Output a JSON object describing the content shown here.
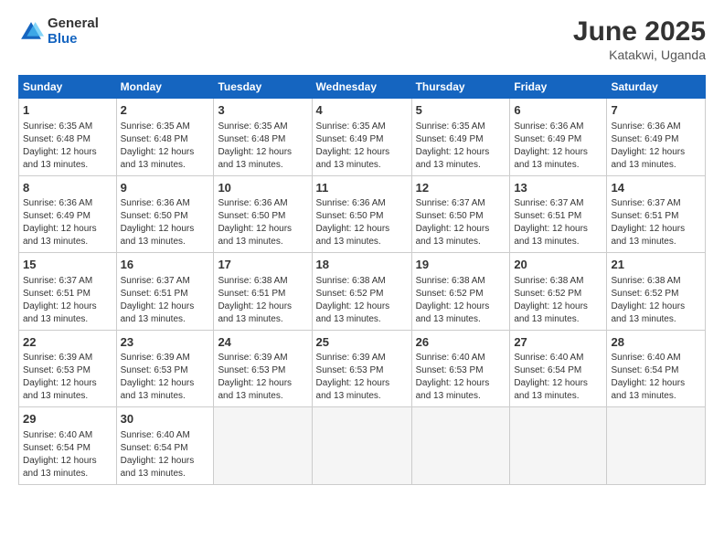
{
  "logo": {
    "general": "General",
    "blue": "Blue"
  },
  "title": {
    "month": "June 2025",
    "location": "Katakwi, Uganda"
  },
  "weekdays": [
    "Sunday",
    "Monday",
    "Tuesday",
    "Wednesday",
    "Thursday",
    "Friday",
    "Saturday"
  ],
  "weeks": [
    [
      {
        "day": "1",
        "sunrise": "6:35 AM",
        "sunset": "6:48 PM",
        "daylight": "12 hours and 13 minutes."
      },
      {
        "day": "2",
        "sunrise": "6:35 AM",
        "sunset": "6:48 PM",
        "daylight": "12 hours and 13 minutes."
      },
      {
        "day": "3",
        "sunrise": "6:35 AM",
        "sunset": "6:48 PM",
        "daylight": "12 hours and 13 minutes."
      },
      {
        "day": "4",
        "sunrise": "6:35 AM",
        "sunset": "6:49 PM",
        "daylight": "12 hours and 13 minutes."
      },
      {
        "day": "5",
        "sunrise": "6:35 AM",
        "sunset": "6:49 PM",
        "daylight": "12 hours and 13 minutes."
      },
      {
        "day": "6",
        "sunrise": "6:36 AM",
        "sunset": "6:49 PM",
        "daylight": "12 hours and 13 minutes."
      },
      {
        "day": "7",
        "sunrise": "6:36 AM",
        "sunset": "6:49 PM",
        "daylight": "12 hours and 13 minutes."
      }
    ],
    [
      {
        "day": "8",
        "sunrise": "6:36 AM",
        "sunset": "6:49 PM",
        "daylight": "12 hours and 13 minutes."
      },
      {
        "day": "9",
        "sunrise": "6:36 AM",
        "sunset": "6:50 PM",
        "daylight": "12 hours and 13 minutes."
      },
      {
        "day": "10",
        "sunrise": "6:36 AM",
        "sunset": "6:50 PM",
        "daylight": "12 hours and 13 minutes."
      },
      {
        "day": "11",
        "sunrise": "6:36 AM",
        "sunset": "6:50 PM",
        "daylight": "12 hours and 13 minutes."
      },
      {
        "day": "12",
        "sunrise": "6:37 AM",
        "sunset": "6:50 PM",
        "daylight": "12 hours and 13 minutes."
      },
      {
        "day": "13",
        "sunrise": "6:37 AM",
        "sunset": "6:51 PM",
        "daylight": "12 hours and 13 minutes."
      },
      {
        "day": "14",
        "sunrise": "6:37 AM",
        "sunset": "6:51 PM",
        "daylight": "12 hours and 13 minutes."
      }
    ],
    [
      {
        "day": "15",
        "sunrise": "6:37 AM",
        "sunset": "6:51 PM",
        "daylight": "12 hours and 13 minutes."
      },
      {
        "day": "16",
        "sunrise": "6:37 AM",
        "sunset": "6:51 PM",
        "daylight": "12 hours and 13 minutes."
      },
      {
        "day": "17",
        "sunrise": "6:38 AM",
        "sunset": "6:51 PM",
        "daylight": "12 hours and 13 minutes."
      },
      {
        "day": "18",
        "sunrise": "6:38 AM",
        "sunset": "6:52 PM",
        "daylight": "12 hours and 13 minutes."
      },
      {
        "day": "19",
        "sunrise": "6:38 AM",
        "sunset": "6:52 PM",
        "daylight": "12 hours and 13 minutes."
      },
      {
        "day": "20",
        "sunrise": "6:38 AM",
        "sunset": "6:52 PM",
        "daylight": "12 hours and 13 minutes."
      },
      {
        "day": "21",
        "sunrise": "6:38 AM",
        "sunset": "6:52 PM",
        "daylight": "12 hours and 13 minutes."
      }
    ],
    [
      {
        "day": "22",
        "sunrise": "6:39 AM",
        "sunset": "6:53 PM",
        "daylight": "12 hours and 13 minutes."
      },
      {
        "day": "23",
        "sunrise": "6:39 AM",
        "sunset": "6:53 PM",
        "daylight": "12 hours and 13 minutes."
      },
      {
        "day": "24",
        "sunrise": "6:39 AM",
        "sunset": "6:53 PM",
        "daylight": "12 hours and 13 minutes."
      },
      {
        "day": "25",
        "sunrise": "6:39 AM",
        "sunset": "6:53 PM",
        "daylight": "12 hours and 13 minutes."
      },
      {
        "day": "26",
        "sunrise": "6:40 AM",
        "sunset": "6:53 PM",
        "daylight": "12 hours and 13 minutes."
      },
      {
        "day": "27",
        "sunrise": "6:40 AM",
        "sunset": "6:54 PM",
        "daylight": "12 hours and 13 minutes."
      },
      {
        "day": "28",
        "sunrise": "6:40 AM",
        "sunset": "6:54 PM",
        "daylight": "12 hours and 13 minutes."
      }
    ],
    [
      {
        "day": "29",
        "sunrise": "6:40 AM",
        "sunset": "6:54 PM",
        "daylight": "12 hours and 13 minutes."
      },
      {
        "day": "30",
        "sunrise": "6:40 AM",
        "sunset": "6:54 PM",
        "daylight": "12 hours and 13 minutes."
      },
      null,
      null,
      null,
      null,
      null
    ]
  ]
}
